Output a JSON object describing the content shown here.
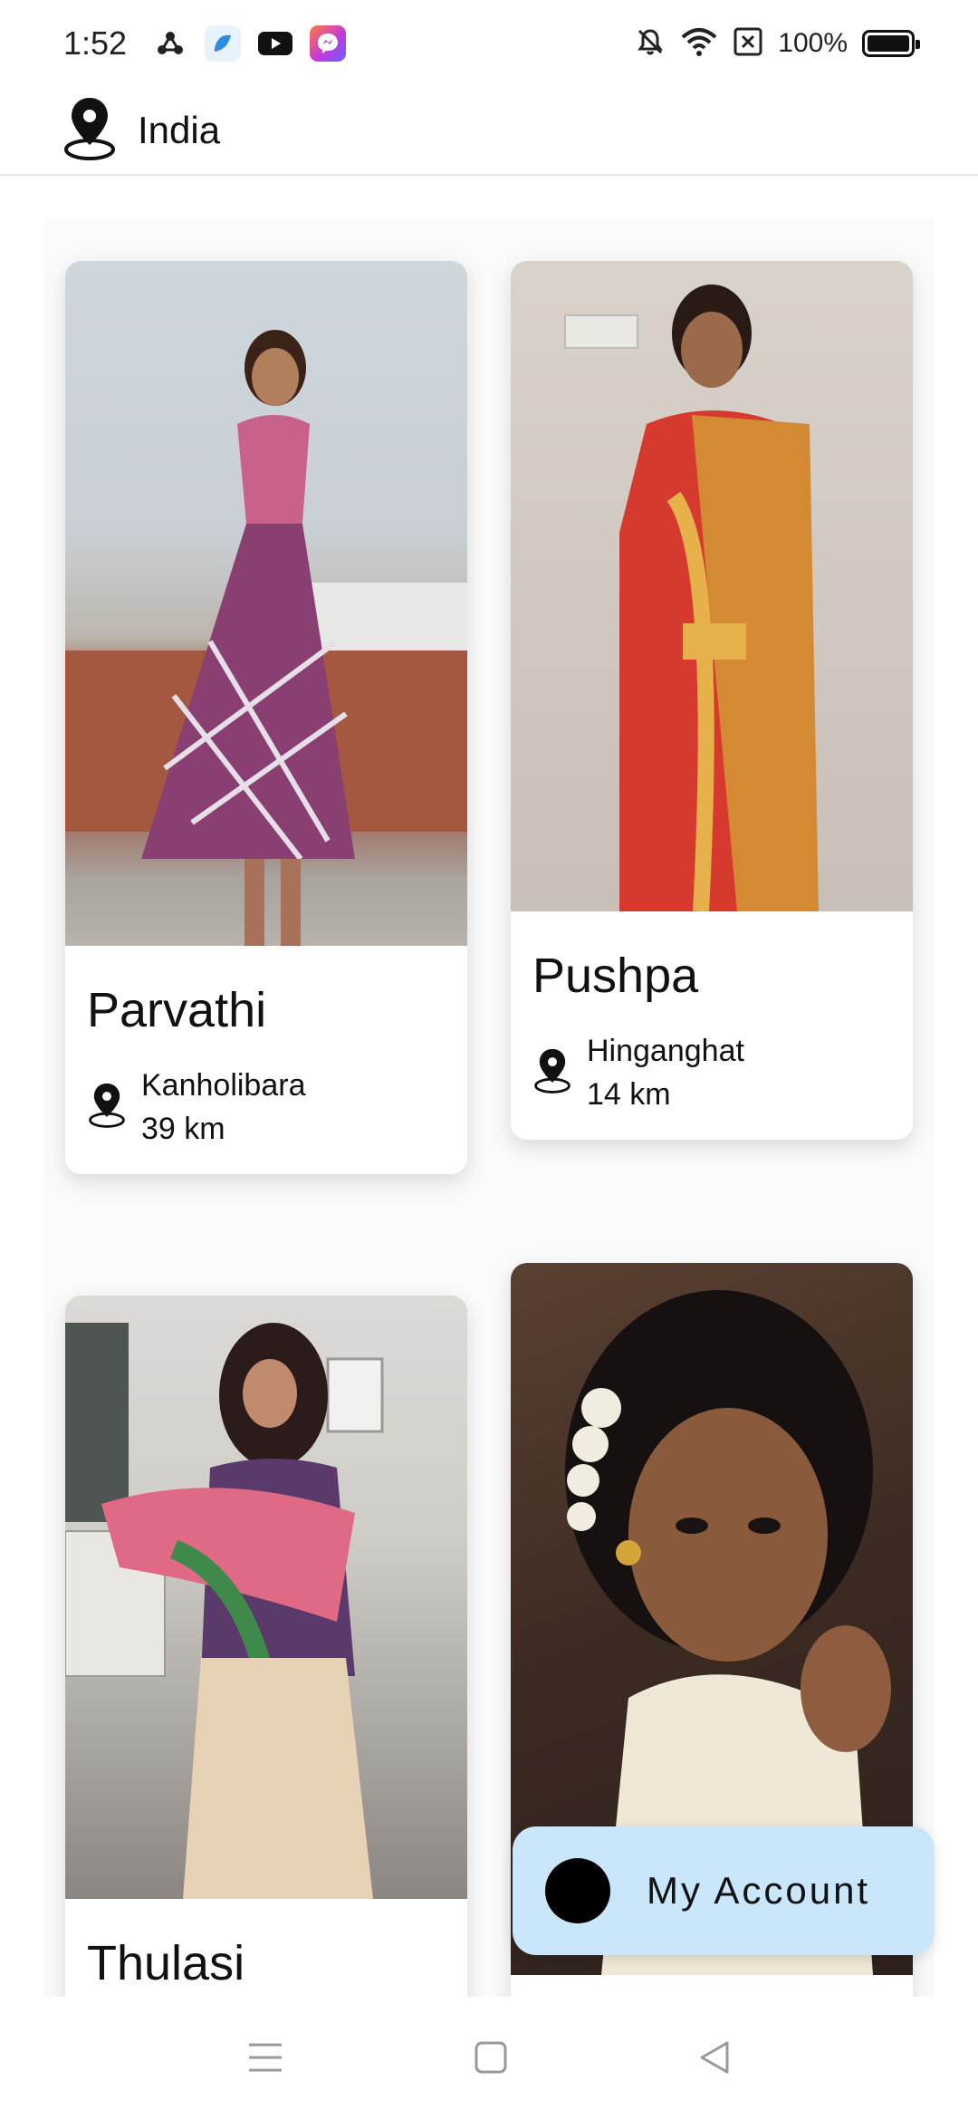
{
  "status": {
    "time": "1:52",
    "battery": "100%",
    "icons": [
      "triskelion-app-icon",
      "blue-app-icon",
      "youtube-icon",
      "messenger-icon",
      "mute-icon",
      "wifi-icon",
      "sim-x-icon",
      "battery-icon"
    ]
  },
  "header": {
    "location_label": "India",
    "icon": "location-pin-icon"
  },
  "profiles": [
    {
      "name": "Parvathi",
      "place": "Kanholibara",
      "distance": "39 km"
    },
    {
      "name": "Pushpa",
      "place": "Hinganghat",
      "distance": "14 km"
    },
    {
      "name": "Thulasi",
      "place": "",
      "distance": ""
    },
    {
      "name": "",
      "place": "",
      "distance": ""
    }
  ],
  "fab": {
    "label": "My Account"
  },
  "navigation": {
    "buttons": [
      "menu",
      "home",
      "back"
    ]
  },
  "colors": {
    "fab_bg": "#c9e6fb",
    "accent": "#000000"
  }
}
